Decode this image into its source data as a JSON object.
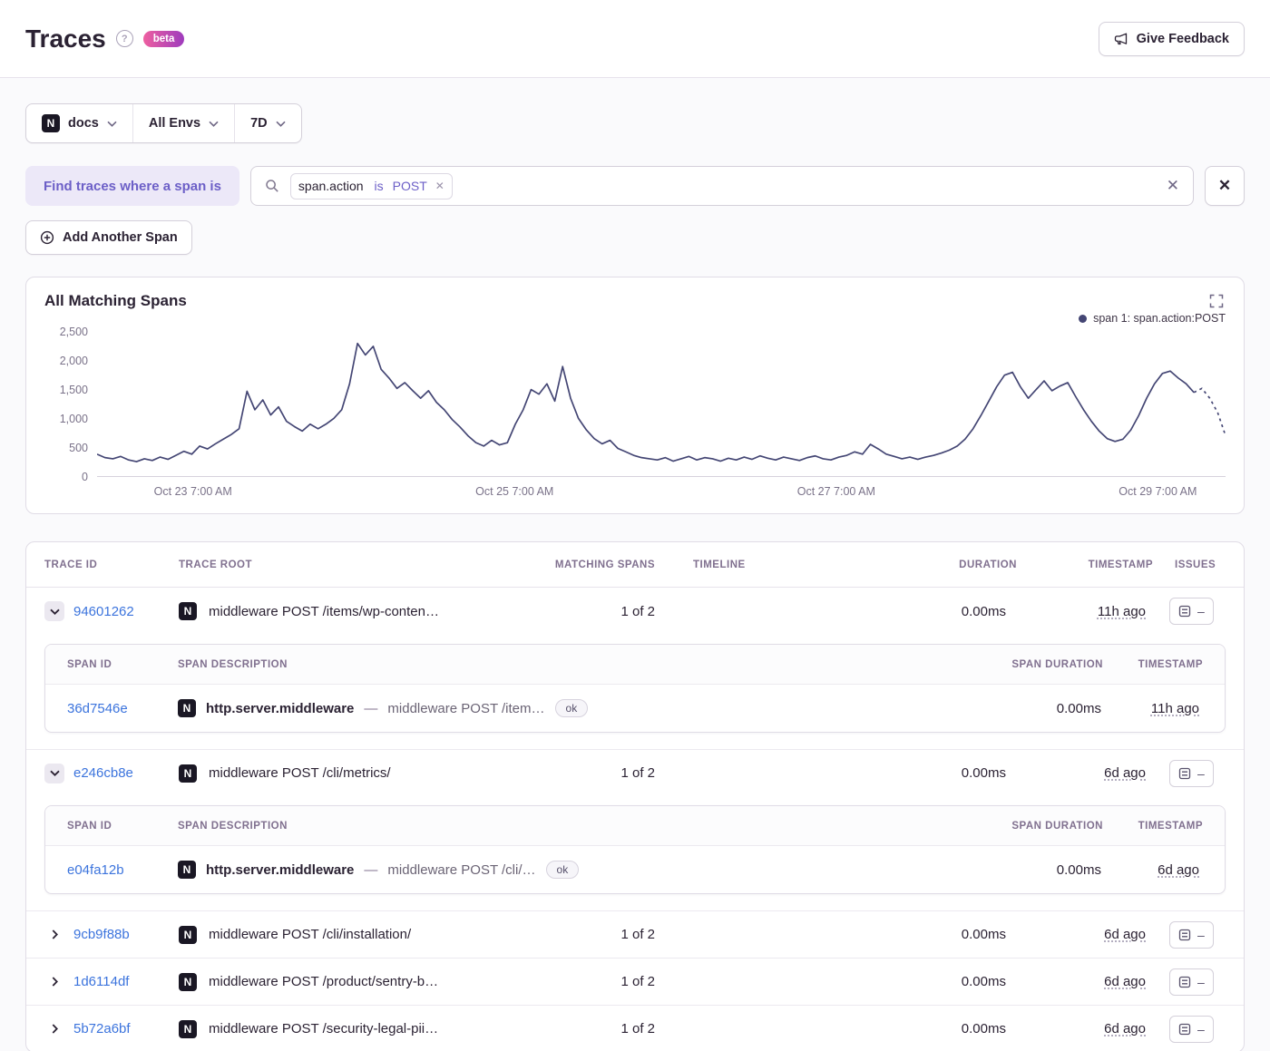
{
  "header": {
    "title": "Traces",
    "beta": "beta",
    "feedback": "Give Feedback"
  },
  "filters": {
    "project": "docs",
    "env": "All Envs",
    "range": "7D"
  },
  "search": {
    "chip": "Find traces where a span is",
    "token_key": "span.action",
    "token_op": "is",
    "token_value": "POST",
    "add_span": "Add Another Span"
  },
  "icons": {
    "project_letter": "N"
  },
  "chart_data": {
    "type": "line",
    "title": "All Matching Spans",
    "series": [
      {
        "name": "span 1: span.action:POST",
        "values": [
          380,
          320,
          300,
          340,
          280,
          250,
          300,
          270,
          330,
          290,
          360,
          430,
          380,
          520,
          470,
          560,
          640,
          720,
          820,
          1470,
          1150,
          1320,
          1060,
          1200,
          950,
          860,
          780,
          900,
          820,
          900,
          1000,
          1150,
          1600,
          2300,
          2100,
          2250,
          1850,
          1700,
          1520,
          1620,
          1480,
          1350,
          1480,
          1280,
          1150,
          980,
          850,
          700,
          580,
          520,
          620,
          540,
          580,
          900,
          1150,
          1500,
          1420,
          1600,
          1300,
          1900,
          1350,
          1000,
          800,
          650,
          560,
          620,
          480,
          420,
          360,
          320,
          300,
          280,
          320,
          260,
          300,
          340,
          280,
          320,
          300,
          260,
          310,
          280,
          330,
          290,
          350,
          310,
          280,
          330,
          300,
          270,
          320,
          350,
          300,
          280,
          330,
          360,
          420,
          380,
          550,
          470,
          380,
          340,
          300,
          330,
          290,
          330,
          360,
          400,
          450,
          520,
          640,
          820,
          1050,
          1300,
          1550,
          1750,
          1800,
          1550,
          1350,
          1500,
          1650,
          1480,
          1560,
          1620,
          1380,
          1150,
          950,
          780,
          650,
          600,
          640,
          800,
          1050,
          1350,
          1600,
          1780,
          1820,
          1700,
          1600,
          1450,
          1520,
          1350,
          1100,
          700
        ]
      }
    ],
    "ylim": [
      0,
      2500
    ],
    "yticks": [
      "2,500",
      "2,000",
      "1,500",
      "1,000",
      "500",
      "0"
    ],
    "xticks": [
      "Oct 23 7:00 AM",
      "Oct 25 7:00 AM",
      "Oct 27 7:00 AM",
      "Oct 29 7:00 AM"
    ],
    "xtick_pos": [
      8.5,
      37,
      65.5,
      94
    ],
    "line_color": "#444674",
    "grid": false,
    "legend_position": "top-right"
  },
  "table": {
    "columns": [
      "Trace ID",
      "Trace Root",
      "Matching Spans",
      "Timeline",
      "Duration",
      "Timestamp",
      "Issues"
    ],
    "sub_columns": [
      "Span ID",
      "Span Description",
      "Span Duration",
      "Timestamp"
    ],
    "issues_empty": "–",
    "rows": [
      {
        "id": "94601262",
        "root": "middleware POST /items/wp-conten…",
        "matching": "1 of 2",
        "duration": "0.00ms",
        "timestamp": "11h ago",
        "spans": [
          {
            "id": "36d7546e",
            "op": "http.server.middleware",
            "sep": "—",
            "desc": "middleware POST /item…",
            "status": "ok",
            "duration": "0.00ms",
            "timestamp": "11h ago"
          }
        ]
      },
      {
        "id": "e246cb8e",
        "root": "middleware POST /cli/metrics/",
        "matching": "1 of 2",
        "duration": "0.00ms",
        "timestamp": "6d ago",
        "spans": [
          {
            "id": "e04fa12b",
            "op": "http.server.middleware",
            "sep": "—",
            "desc": "middleware POST /cli/…",
            "status": "ok",
            "duration": "0.00ms",
            "timestamp": "6d ago"
          }
        ]
      },
      {
        "id": "9cb9f88b",
        "root": "middleware POST /cli/installation/",
        "matching": "1 of 2",
        "duration": "0.00ms",
        "timestamp": "6d ago"
      },
      {
        "id": "1d6114df",
        "root": "middleware POST /product/sentry-b…",
        "matching": "1 of 2",
        "duration": "0.00ms",
        "timestamp": "6d ago"
      },
      {
        "id": "5b72a6bf",
        "root": "middleware POST /security-legal-pii…",
        "matching": "1 of 2",
        "duration": "0.00ms",
        "timestamp": "6d ago"
      }
    ]
  }
}
